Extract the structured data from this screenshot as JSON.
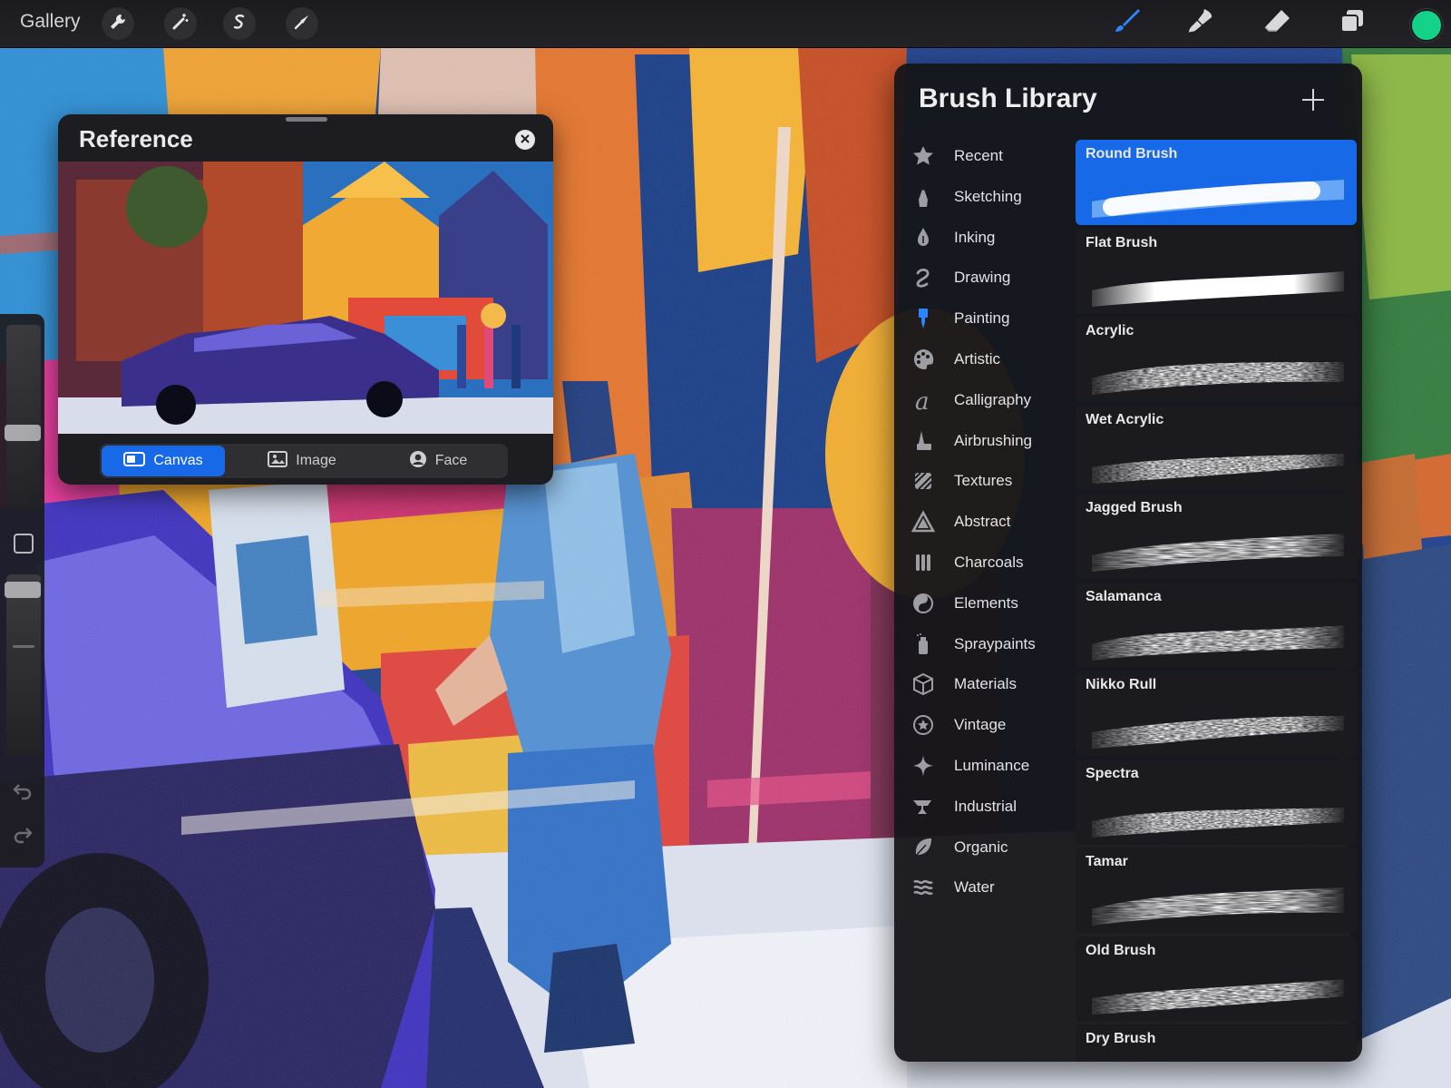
{
  "toolbar": {
    "gallery_label": "Gallery",
    "left_tools": [
      "wrench-icon",
      "magic-wand-icon",
      "selection-icon",
      "transform-arrow-icon"
    ],
    "right_tools": [
      "brush-icon",
      "smudge-icon",
      "eraser-icon",
      "layers-icon"
    ],
    "active_tool": "brush",
    "color": "#14d28a",
    "accent": "#1769e8"
  },
  "sidebar": {
    "brush_size_level": 0.4,
    "opacity_level": 0.05,
    "icons": [
      "modify-button",
      "undo-icon",
      "redo-icon"
    ]
  },
  "reference": {
    "title": "Reference",
    "tabs": [
      {
        "label": "Canvas",
        "icon": "canvas-icon",
        "active": true
      },
      {
        "label": "Image",
        "icon": "image-icon",
        "active": false
      },
      {
        "label": "Face",
        "icon": "face-icon",
        "active": false
      }
    ]
  },
  "brush_library": {
    "title": "Brush Library",
    "categories": [
      {
        "label": "Recent",
        "icon": "star-icon"
      },
      {
        "label": "Sketching",
        "icon": "pencil-icon"
      },
      {
        "label": "Inking",
        "icon": "ink-drop-icon"
      },
      {
        "label": "Drawing",
        "icon": "squiggle-icon"
      },
      {
        "label": "Painting",
        "icon": "paintbrush-icon"
      },
      {
        "label": "Artistic",
        "icon": "palette-icon"
      },
      {
        "label": "Calligraphy",
        "icon": "calligraphy-icon"
      },
      {
        "label": "Airbrushing",
        "icon": "airbrush-icon"
      },
      {
        "label": "Textures",
        "icon": "texture-icon"
      },
      {
        "label": "Abstract",
        "icon": "triangle-icon"
      },
      {
        "label": "Charcoals",
        "icon": "charcoal-icon"
      },
      {
        "label": "Elements",
        "icon": "yin-yang-icon"
      },
      {
        "label": "Spraypaints",
        "icon": "spray-can-icon"
      },
      {
        "label": "Materials",
        "icon": "cube-icon"
      },
      {
        "label": "Vintage",
        "icon": "vintage-star-icon"
      },
      {
        "label": "Luminance",
        "icon": "sparkle-icon"
      },
      {
        "label": "Industrial",
        "icon": "anvil-icon"
      },
      {
        "label": "Organic",
        "icon": "leaf-icon"
      },
      {
        "label": "Water",
        "icon": "waves-icon"
      }
    ],
    "brushes": [
      {
        "name": "Round Brush",
        "active": true
      },
      {
        "name": "Flat Brush",
        "active": false
      },
      {
        "name": "Acrylic",
        "active": false
      },
      {
        "name": "Wet Acrylic",
        "active": false
      },
      {
        "name": "Jagged Brush",
        "active": false
      },
      {
        "name": "Salamanca",
        "active": false
      },
      {
        "name": "Nikko Rull",
        "active": false
      },
      {
        "name": "Spectra",
        "active": false
      },
      {
        "name": "Tamar",
        "active": false
      },
      {
        "name": "Old Brush",
        "active": false
      },
      {
        "name": "Dry Brush",
        "active": false
      }
    ]
  }
}
